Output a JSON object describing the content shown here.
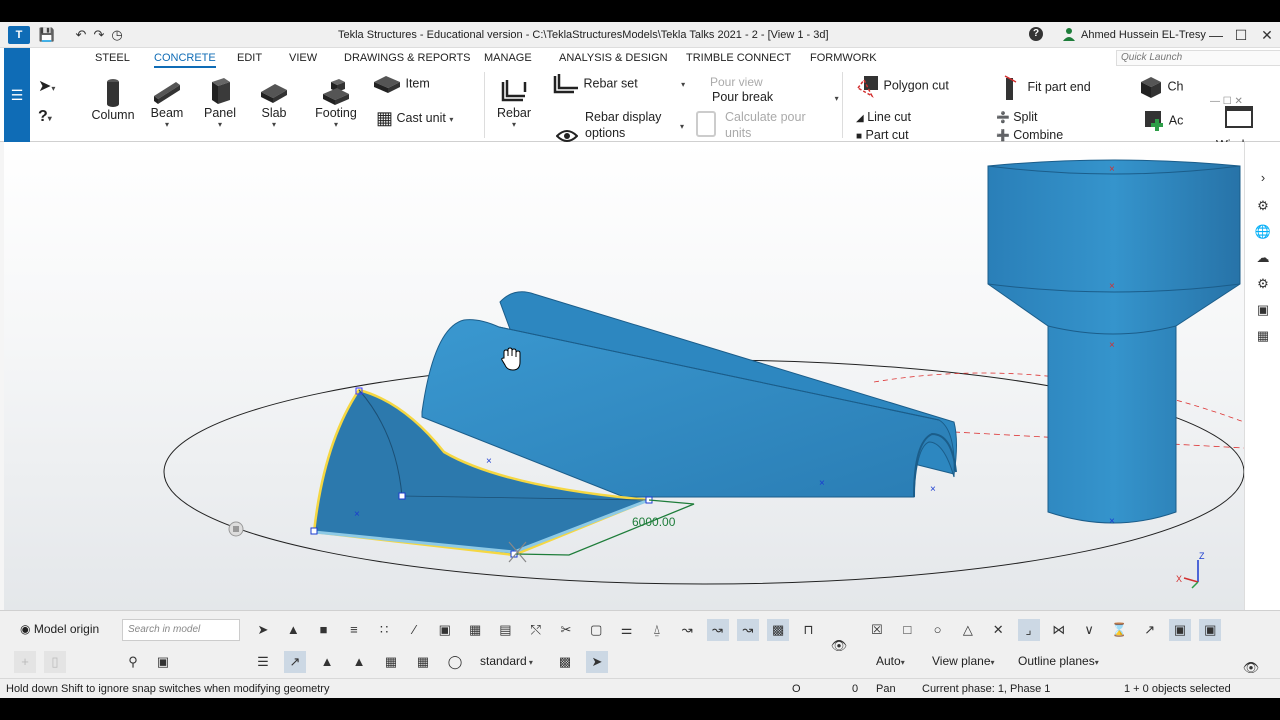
{
  "window": {
    "title": "Tekla Structures - Educational version - C:\\TeklaStructuresModels\\Tekla Talks 2021 - 2  - [View 1 - 3d]",
    "user": "Ahmed Hussein EL-Tresy",
    "help": "?"
  },
  "ribbon": {
    "tabs": [
      "STEEL",
      "CONCRETE",
      "EDIT",
      "VIEW",
      "DRAWINGS & REPORTS",
      "MANAGE",
      "ANALYSIS & DESIGN",
      "TRIMBLE CONNECT",
      "FORMWORK"
    ],
    "active_tab": "CONCRETE",
    "quick_launch_placeholder": "Quick Launch",
    "buttons": {
      "column": "Column",
      "beam": "Beam",
      "panel": "Panel",
      "slab": "Slab",
      "footing": "Footing",
      "item": "Item",
      "cast_unit": "Cast unit",
      "rebar": "Rebar",
      "rebar_set": "Rebar set",
      "rebar_display_options_1": "Rebar display",
      "rebar_display_options_2": "options",
      "pour_view": "Pour view",
      "pour_break": "Pour break",
      "calc_pour_1": "Calculate pour",
      "calc_pour_2": "units",
      "polygon_cut": "Polygon cut",
      "line_cut": "Line cut",
      "part_cut": "Part cut",
      "fit_part_end": "Fit part end",
      "split": "Split",
      "combine": "Combine",
      "ch": "Ch",
      "ac": "Ac",
      "window": "Window"
    }
  },
  "viewport": {
    "dimension_label": "6000.00",
    "axis_z": "Z",
    "axis_x": "X"
  },
  "bottom_toolbar": {
    "model_origin": "Model origin",
    "search_placeholder": "Search in model",
    "standard": "standard",
    "auto": "Auto",
    "view_plane": "View plane",
    "outline_planes": "Outline planes"
  },
  "status_bar": {
    "hint": "Hold down Shift to ignore snap switches when modifying geometry",
    "o": "O",
    "zero": "0",
    "mode": "Pan",
    "phase": "Current phase: 1, Phase 1",
    "selection": "1 + 0 objects selected"
  },
  "colors": {
    "accent": "#0f6cb6",
    "part_fill": "#2e86c1",
    "selection_outline": "#f5d742",
    "dimension": "#1e7d3a"
  }
}
